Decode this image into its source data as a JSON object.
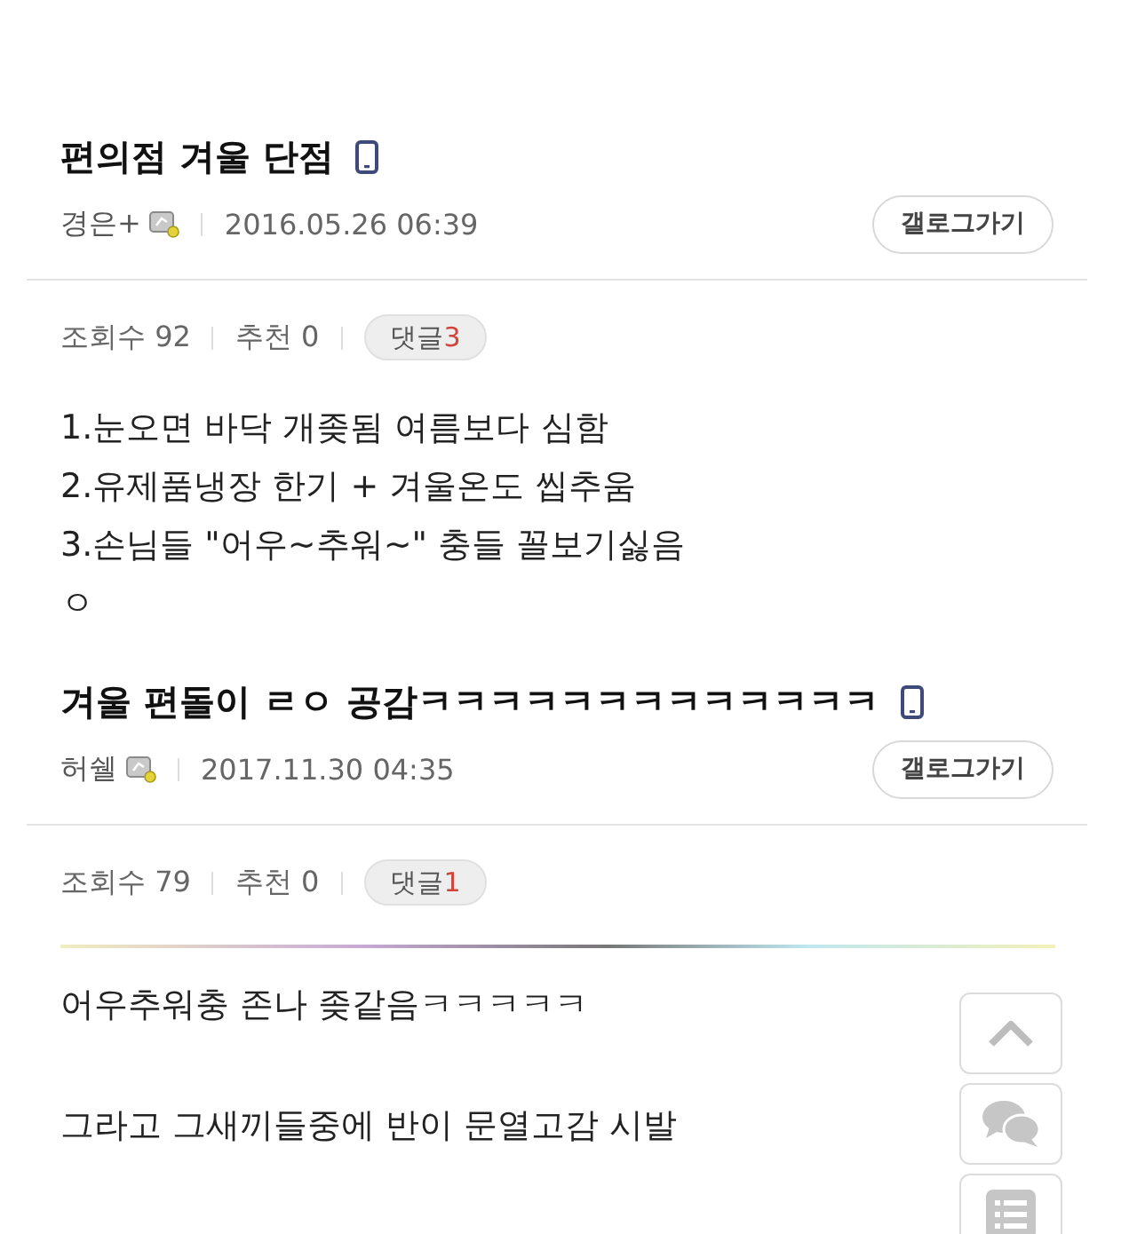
{
  "posts": [
    {
      "title": "편의점 겨울 단점",
      "author": "경은+",
      "date": "2016.05.26 06:39",
      "gallog_button": "갤로그가기",
      "views": "조회수 92",
      "recommends": "추천 0",
      "comment_label": "댓글",
      "comment_count": "3",
      "gradient_rule": false,
      "paragraphs": [
        [
          "1.눈오면 바닥 개좆됨 여름보다 심함",
          "2.유제품냉장 한기 + 겨울온도 씹추움",
          "3.손님들 \"어우~추워~\" 충들 꼴보기싫음",
          "ㅇ"
        ]
      ]
    },
    {
      "title": "겨울 편돌이 ㄹㅇ 공감ㅋㅋㅋㅋㅋㅋㅋㅋㅋㅋㅋㅋㅋ",
      "author": "허쉘",
      "date": "2017.11.30 04:35",
      "gallog_button": "갤로그가기",
      "views": "조회수 79",
      "recommends": "추천 0",
      "comment_label": "댓글",
      "comment_count": "1",
      "gradient_rule": true,
      "paragraphs": [
        [
          "어우추워충 존나 좆같음ㅋㅋㅋㅋㅋ"
        ],
        [
          "그라고 그새끼들중에 반이 문열고감 시발"
        ]
      ]
    }
  ],
  "side_buttons": [
    {
      "kind": "up"
    },
    {
      "kind": "chat"
    },
    {
      "kind": "list"
    }
  ]
}
